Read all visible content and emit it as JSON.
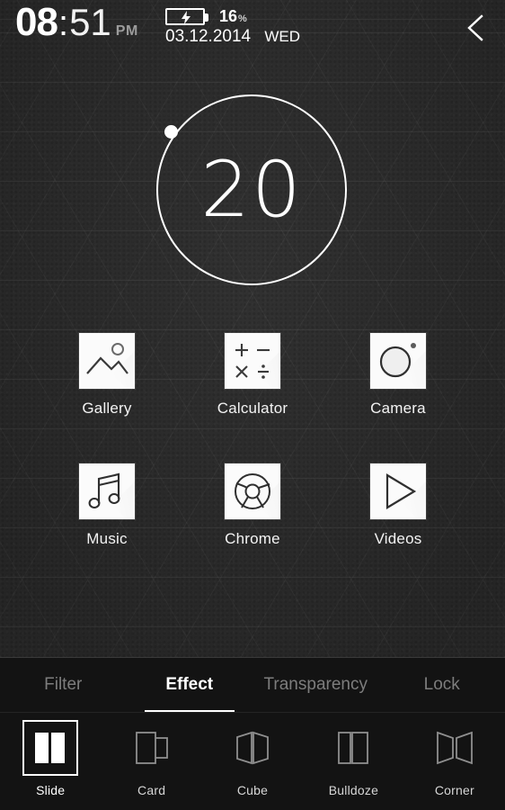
{
  "status_bar": {
    "hours": "08",
    "colon": ":",
    "minutes": "51",
    "ampm": "PM",
    "battery_percent": "16",
    "percent_symbol": "%",
    "battery_icon": "battery-charging-icon",
    "date": "03.12.2014",
    "day_of_week": "WED",
    "back_icon": "chevron-left-icon"
  },
  "ring_widget": {
    "value": "20",
    "knob_icon": "ring-knob-handle"
  },
  "apps": {
    "rows": [
      [
        {
          "label": "Gallery",
          "icon": "gallery-icon"
        },
        {
          "label": "Calculator",
          "icon": "calculator-icon"
        },
        {
          "label": "Camera",
          "icon": "camera-icon"
        }
      ],
      [
        {
          "label": "Music",
          "icon": "music-note-icon"
        },
        {
          "label": "Chrome",
          "icon": "chrome-icon"
        },
        {
          "label": "Videos",
          "icon": "play-triangle-icon"
        }
      ]
    ]
  },
  "sheet": {
    "tabs": [
      {
        "label": "Filter",
        "active": false
      },
      {
        "label": "Effect",
        "active": true
      },
      {
        "label": "Transparency",
        "active": false
      },
      {
        "label": "Lock",
        "active": false
      }
    ],
    "effects": [
      {
        "label": "Slide",
        "icon": "effect-slide-icon",
        "selected": true
      },
      {
        "label": "Card",
        "icon": "effect-card-icon",
        "selected": false
      },
      {
        "label": "Cube",
        "icon": "effect-cube-icon",
        "selected": false
      },
      {
        "label": "Bulldoze",
        "icon": "effect-bulldoze-icon",
        "selected": false
      },
      {
        "label": "Corner",
        "icon": "effect-corner-icon",
        "selected": false
      }
    ]
  },
  "colors": {
    "wallpaper": "#2d2d2d",
    "sheet": "#131313",
    "accent": "#ffffff",
    "inactive_text": "#7d7d7d"
  }
}
